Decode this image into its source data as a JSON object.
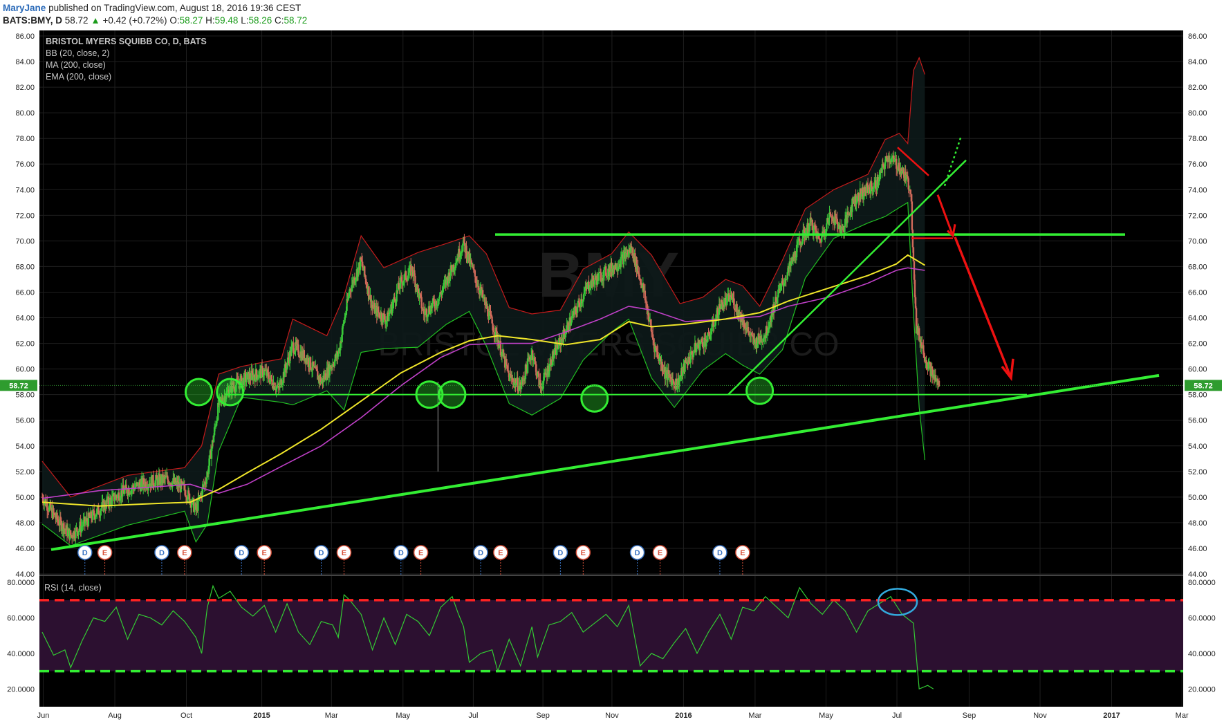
{
  "header": {
    "author": "MaryJane",
    "published": "published on TradingView.com, August 18, 2016 19:36 CEST",
    "symbol": "BATS:BMY, D",
    "last": "58.72",
    "change": "+0.42 (+0.72%)",
    "open_label": "O:",
    "open": "58.27",
    "high_label": "H:",
    "high": "59.48",
    "low_label": "L:",
    "low": "58.26",
    "close_label": "C:",
    "close": "58.72"
  },
  "legend": {
    "title": "BRISTOL MYERS SQUIBB CO, D, BATS",
    "bb": "BB (20, close, 2)",
    "ma": "MA (200, close)",
    "ema": "EMA (200, close)",
    "rsi": "RSI (14, close)",
    "watermark_symbol": "BMY",
    "watermark_name": "BRISTOL MYERS SQUIBB CO"
  },
  "colors": {
    "background": "#000000",
    "grid": "#1f1f1f",
    "up": "#39c839",
    "down": "#d06a5a",
    "bb_upper": "#c41b1b",
    "bb_lower": "#22c022",
    "ma": "#f0e62a",
    "ema": "#c040c8",
    "trend": "#33ee33",
    "arrow": "#ee1111",
    "rsi_line": "#33cc33",
    "rsi_over": "#ff2222",
    "rsi_under": "#33ee33",
    "rsi_band": "#2c1030",
    "ellipse": "#33aadd"
  },
  "chart_data": [
    {
      "type": "candlestick",
      "title": "BRISTOL MYERS SQUIBB CO, D, BATS",
      "ylim": [
        44,
        86
      ],
      "y_ticks": [
        "86.00",
        "84.00",
        "82.00",
        "80.00",
        "78.00",
        "76.00",
        "74.00",
        "72.00",
        "70.00",
        "68.00",
        "66.00",
        "64.00",
        "62.00",
        "60.00",
        "58.00",
        "56.00",
        "54.00",
        "52.00",
        "50.00",
        "48.00",
        "46.00",
        "44.00"
      ],
      "x_ticks": [
        "Jun",
        "Aug",
        "Oct",
        "2015",
        "Mar",
        "May",
        "Jul",
        "Sep",
        "Nov",
        "2016",
        "Mar",
        "May",
        "Jul",
        "Sep",
        "Nov",
        "2017",
        "Mar"
      ],
      "last_price": "58.72",
      "price_path": [
        [
          0,
          50.0
        ],
        [
          5,
          48.3
        ],
        [
          10,
          47.0
        ],
        [
          16,
          48.2
        ],
        [
          22,
          49.4
        ],
        [
          28,
          50.4
        ],
        [
          36,
          51.1
        ],
        [
          44,
          51.4
        ],
        [
          50,
          50.6
        ],
        [
          54,
          49.0
        ],
        [
          58,
          51.8
        ],
        [
          62,
          57.2
        ],
        [
          66,
          58.5
        ],
        [
          72,
          59.3
        ],
        [
          78,
          59.8
        ],
        [
          83,
          58.4
        ],
        [
          88,
          61.8
        ],
        [
          93,
          60.8
        ],
        [
          98,
          59.0
        ],
        [
          104,
          61.2
        ],
        [
          108,
          66.2
        ],
        [
          112,
          68.4
        ],
        [
          116,
          64.8
        ],
        [
          121,
          63.8
        ],
        [
          126,
          66.8
        ],
        [
          130,
          67.8
        ],
        [
          134,
          64.3
        ],
        [
          139,
          65.4
        ],
        [
          143,
          67.4
        ],
        [
          148,
          69.8
        ],
        [
          152,
          67.2
        ],
        [
          156,
          64.8
        ],
        [
          160,
          62.3
        ],
        [
          164,
          59.4
        ],
        [
          168,
          58.6
        ],
        [
          172,
          61.4
        ],
        [
          175,
          58.5
        ],
        [
          179,
          60.8
        ],
        [
          183,
          62.6
        ],
        [
          187,
          64.4
        ],
        [
          192,
          66.6
        ],
        [
          197,
          67.4
        ],
        [
          202,
          68.2
        ],
        [
          207,
          69.4
        ],
        [
          211,
          66.3
        ],
        [
          215,
          61.8
        ],
        [
          219,
          59.6
        ],
        [
          223,
          58.8
        ],
        [
          226,
          60.4
        ],
        [
          230,
          61.8
        ],
        [
          234,
          62.4
        ],
        [
          238,
          64.9
        ],
        [
          242,
          65.6
        ],
        [
          246,
          63.8
        ],
        [
          250,
          62.0
        ],
        [
          254,
          62.7
        ],
        [
          258,
          65.6
        ],
        [
          262,
          67.6
        ],
        [
          266,
          69.9
        ],
        [
          270,
          71.4
        ],
        [
          273,
          70.0
        ],
        [
          277,
          72.1
        ],
        [
          281,
          70.8
        ],
        [
          285,
          73.2
        ],
        [
          289,
          73.9
        ],
        [
          293,
          74.4
        ],
        [
          297,
          76.6
        ],
        [
          301,
          75.8
        ],
        [
          303,
          75.0
        ],
        [
          305,
          74.1
        ],
        [
          307,
          63.2
        ],
        [
          309,
          61.8
        ],
        [
          311,
          60.4
        ],
        [
          313,
          59.4
        ],
        [
          315,
          58.72
        ]
      ],
      "bb_upper_path": [
        [
          0,
          52.8
        ],
        [
          10,
          50.0
        ],
        [
          30,
          51.7
        ],
        [
          50,
          52.3
        ],
        [
          56,
          54.0
        ],
        [
          62,
          59.6
        ],
        [
          70,
          60.2
        ],
        [
          84,
          60.8
        ],
        [
          88,
          63.9
        ],
        [
          100,
          62.6
        ],
        [
          106,
          65.7
        ],
        [
          112,
          70.4
        ],
        [
          120,
          67.9
        ],
        [
          132,
          69.1
        ],
        [
          142,
          69.8
        ],
        [
          150,
          70.4
        ],
        [
          156,
          69.0
        ],
        [
          164,
          64.8
        ],
        [
          172,
          64.3
        ],
        [
          182,
          64.6
        ],
        [
          190,
          67.8
        ],
        [
          200,
          69.0
        ],
        [
          206,
          70.7
        ],
        [
          214,
          68.9
        ],
        [
          224,
          65.1
        ],
        [
          232,
          65.6
        ],
        [
          240,
          67.0
        ],
        [
          246,
          66.5
        ],
        [
          252,
          64.9
        ],
        [
          260,
          68.5
        ],
        [
          268,
          72.5
        ],
        [
          278,
          74.0
        ],
        [
          290,
          75.2
        ],
        [
          296,
          77.9
        ],
        [
          301,
          78.4
        ],
        [
          304,
          77.6
        ],
        [
          306,
          83.3
        ],
        [
          308,
          84.3
        ],
        [
          310,
          83.0
        ]
      ],
      "bb_lower_path": [
        [
          0,
          47.9
        ],
        [
          10,
          46.2
        ],
        [
          30,
          47.8
        ],
        [
          50,
          48.9
        ],
        [
          54,
          46.5
        ],
        [
          58,
          47.9
        ],
        [
          62,
          53.6
        ],
        [
          70,
          57.8
        ],
        [
          84,
          57.4
        ],
        [
          88,
          57.2
        ],
        [
          100,
          58.3
        ],
        [
          106,
          56.8
        ],
        [
          112,
          61.3
        ],
        [
          120,
          61.6
        ],
        [
          132,
          61.7
        ],
        [
          142,
          63.5
        ],
        [
          150,
          64.5
        ],
        [
          156,
          61.8
        ],
        [
          164,
          57.3
        ],
        [
          172,
          56.4
        ],
        [
          182,
          57.7
        ],
        [
          190,
          60.7
        ],
        [
          200,
          62.9
        ],
        [
          206,
          63.9
        ],
        [
          214,
          59.3
        ],
        [
          222,
          57.0
        ],
        [
          232,
          59.9
        ],
        [
          240,
          61.2
        ],
        [
          246,
          60.3
        ],
        [
          252,
          59.6
        ],
        [
          260,
          61.5
        ],
        [
          268,
          67.1
        ],
        [
          278,
          70.2
        ],
        [
          290,
          71.4
        ],
        [
          296,
          71.9
        ],
        [
          301,
          72.6
        ],
        [
          304,
          73.0
        ],
        [
          306,
          64.4
        ],
        [
          308,
          57.0
        ],
        [
          310,
          52.9
        ]
      ],
      "ma_path": [
        [
          0,
          49.6
        ],
        [
          20,
          49.3
        ],
        [
          40,
          49.5
        ],
        [
          52,
          49.6
        ],
        [
          62,
          50.6
        ],
        [
          72,
          51.9
        ],
        [
          84,
          53.4
        ],
        [
          98,
          55.3
        ],
        [
          112,
          57.5
        ],
        [
          126,
          59.7
        ],
        [
          140,
          61.3
        ],
        [
          150,
          62.2
        ],
        [
          160,
          62.6
        ],
        [
          172,
          62.3
        ],
        [
          184,
          61.9
        ],
        [
          196,
          62.3
        ],
        [
          206,
          63.7
        ],
        [
          214,
          63.3
        ],
        [
          226,
          63.5
        ],
        [
          240,
          63.9
        ],
        [
          252,
          64.4
        ],
        [
          262,
          65.3
        ],
        [
          276,
          66.3
        ],
        [
          290,
          67.3
        ],
        [
          300,
          68.2
        ],
        [
          304,
          68.9
        ],
        [
          310,
          68.1
        ]
      ],
      "ema_path": [
        [
          0,
          49.9
        ],
        [
          20,
          50.5
        ],
        [
          40,
          50.8
        ],
        [
          52,
          51.0
        ],
        [
          62,
          50.3
        ],
        [
          72,
          51.0
        ],
        [
          84,
          52.4
        ],
        [
          98,
          54.0
        ],
        [
          112,
          56.2
        ],
        [
          126,
          58.7
        ],
        [
          140,
          60.9
        ],
        [
          150,
          61.9
        ],
        [
          160,
          62.0
        ],
        [
          172,
          62.0
        ],
        [
          184,
          62.9
        ],
        [
          196,
          63.9
        ],
        [
          206,
          64.9
        ],
        [
          214,
          64.6
        ],
        [
          226,
          63.7
        ],
        [
          240,
          63.9
        ],
        [
          252,
          64.1
        ],
        [
          262,
          64.9
        ],
        [
          276,
          65.6
        ],
        [
          290,
          66.7
        ],
        [
          300,
          67.7
        ],
        [
          304,
          67.9
        ],
        [
          310,
          67.7
        ]
      ],
      "annotations": {
        "resistance_level": 70.5,
        "support_level": 58.0,
        "rising_trendline": [
          [
            3,
            45.9
          ],
          [
            312,
            59.5
          ]
        ],
        "dividend_markers_label": "D",
        "earnings_markers_label": "E",
        "dividend_weeks": [
          15,
          42,
          70,
          98,
          126,
          154,
          182,
          209,
          238
        ],
        "earnings_weeks": [
          22,
          50,
          78,
          106,
          133,
          161,
          190,
          217,
          246
        ],
        "support_circles": [
          [
            55,
            58.2
          ],
          [
            66,
            58.2
          ],
          [
            136,
            58.0
          ],
          [
            144,
            58.0
          ],
          [
            194,
            57.7
          ],
          [
            252,
            58.3
          ]
        ]
      }
    },
    {
      "type": "line",
      "title": "RSI (14, close)",
      "ylim": [
        10,
        82
      ],
      "y_ticks": [
        "80.0000",
        "60.0000",
        "40.0000",
        "20.0000"
      ],
      "overbought": 70,
      "oversold": 30,
      "series": [
        {
          "values": [
            [
              0,
              52
            ],
            [
              4,
              39
            ],
            [
              8,
              42
            ],
            [
              10,
              32
            ],
            [
              14,
              47
            ],
            [
              18,
              60
            ],
            [
              22,
              58
            ],
            [
              26,
              66
            ],
            [
              30,
              48
            ],
            [
              34,
              62
            ],
            [
              38,
              60
            ],
            [
              42,
              56
            ],
            [
              46,
              64
            ],
            [
              50,
              58
            ],
            [
              54,
              49
            ],
            [
              56,
              40
            ],
            [
              58,
              66
            ],
            [
              60,
              78
            ],
            [
              62,
              71
            ],
            [
              66,
              75
            ],
            [
              70,
              66
            ],
            [
              74,
              61
            ],
            [
              78,
              67
            ],
            [
              82,
              52
            ],
            [
              86,
              68
            ],
            [
              90,
              52
            ],
            [
              94,
              45
            ],
            [
              98,
              58
            ],
            [
              102,
              56
            ],
            [
              104,
              49
            ],
            [
              106,
              73
            ],
            [
              108,
              70
            ],
            [
              112,
              62
            ],
            [
              116,
              42
            ],
            [
              120,
              60
            ],
            [
              124,
              45
            ],
            [
              128,
              62
            ],
            [
              132,
              58
            ],
            [
              136,
              50
            ],
            [
              140,
              66
            ],
            [
              144,
              72
            ],
            [
              146,
              63
            ],
            [
              148,
              55
            ],
            [
              150,
              35
            ],
            [
              154,
              40
            ],
            [
              158,
              42
            ],
            [
              160,
              30
            ],
            [
              164,
              48
            ],
            [
              168,
              33
            ],
            [
              172,
              55
            ],
            [
              174,
              38
            ],
            [
              178,
              56
            ],
            [
              182,
              58
            ],
            [
              186,
              63
            ],
            [
              190,
              52
            ],
            [
              194,
              57
            ],
            [
              198,
              62
            ],
            [
              202,
              55
            ],
            [
              206,
              67
            ],
            [
              208,
              50
            ],
            [
              210,
              33
            ],
            [
              214,
              40
            ],
            [
              218,
              37
            ],
            [
              222,
              46
            ],
            [
              226,
              54
            ],
            [
              230,
              40
            ],
            [
              234,
              52
            ],
            [
              238,
              62
            ],
            [
              242,
              48
            ],
            [
              246,
              66
            ],
            [
              250,
              64
            ],
            [
              254,
              72
            ],
            [
              258,
              66
            ],
            [
              262,
              60
            ],
            [
              266,
              77
            ],
            [
              270,
              68
            ],
            [
              274,
              62
            ],
            [
              278,
              70
            ],
            [
              282,
              64
            ],
            [
              286,
              52
            ],
            [
              290,
              64
            ],
            [
              294,
              68
            ],
            [
              298,
              72
            ],
            [
              302,
              62
            ],
            [
              306,
              57
            ],
            [
              308,
              20
            ],
            [
              311,
              22
            ],
            [
              313,
              20
            ]
          ]
        }
      ],
      "annotation": "ellipse around RSI peak near July 2016"
    }
  ]
}
